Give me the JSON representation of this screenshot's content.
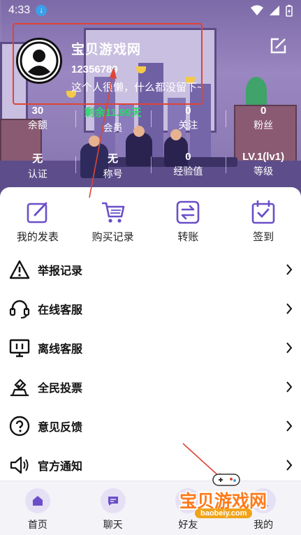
{
  "status_bar": {
    "time": "4:33"
  },
  "profile": {
    "site_name": "宝贝游戏网",
    "user_id": "12356789",
    "bio": "这个人很懒，什么都没留下~"
  },
  "stats_row1": [
    {
      "value": "30",
      "label": "余额",
      "color": "#ffffff"
    },
    {
      "value": "剩余11.99天",
      "label": "会员",
      "color": "#2bd86a"
    },
    {
      "value": "0",
      "label": "关注",
      "color": "#ffffff"
    },
    {
      "value": "0",
      "label": "粉丝",
      "color": "#ffffff"
    }
  ],
  "stats_row2": [
    {
      "value": "无",
      "label": "认证"
    },
    {
      "value": "无",
      "label": "称号"
    },
    {
      "value": "0",
      "label": "经验值"
    },
    {
      "value": "LV.1(lv1)",
      "label": "等级"
    }
  ],
  "quick_actions": [
    {
      "label": "我的发表",
      "icon": "edit-icon"
    },
    {
      "label": "购买记录",
      "icon": "cart-icon"
    },
    {
      "label": "转账",
      "icon": "transfer-icon"
    },
    {
      "label": "签到",
      "icon": "checkin-icon"
    }
  ],
  "menu": [
    {
      "label": "举报记录",
      "icon": "warning-icon"
    },
    {
      "label": "在线客服",
      "icon": "headset-icon"
    },
    {
      "label": "离线客服",
      "icon": "monitor-icon"
    },
    {
      "label": "全民投票",
      "icon": "vote-icon"
    },
    {
      "label": "意见反馈",
      "icon": "question-icon"
    },
    {
      "label": "官方通知",
      "icon": "speaker-icon"
    }
  ],
  "tabs": [
    {
      "label": "首页",
      "icon": "home-icon"
    },
    {
      "label": "聊天",
      "icon": "chat-icon"
    },
    {
      "label": "好友",
      "icon": "friends-icon"
    },
    {
      "label": "我的",
      "icon": "profile-icon"
    }
  ],
  "watermark": {
    "text": "宝贝游戏网",
    "url": "baobeiy.com"
  },
  "colors": {
    "accent": "#6a4fc9",
    "annotation": "#e04433"
  }
}
